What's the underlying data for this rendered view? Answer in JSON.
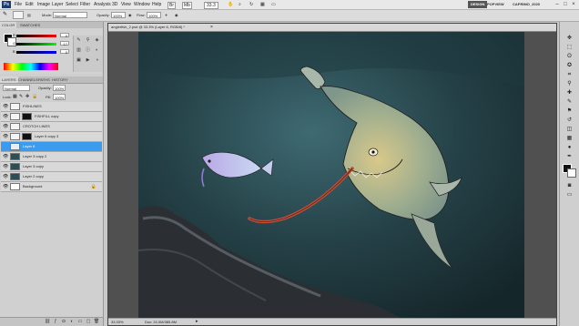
{
  "menu": {
    "items": [
      "File",
      "Edit",
      "Image",
      "Layer",
      "Select",
      "Filter",
      "Analysis",
      "3D",
      "View",
      "Window",
      "Help"
    ],
    "zoom": "33.3"
  },
  "workspaces": {
    "design": "DESIGN",
    "preview": "POPVIEW",
    "painting": "CAPRIMO_2020"
  },
  "window_controls": {
    "minimize": "–",
    "maximize": "□",
    "close": "×"
  },
  "options": {
    "mode_label": "Mode:",
    "mode_value": "Normal",
    "opacity_label": "Opacity:",
    "opacity_value": "100%",
    "flow_label": "Flow:",
    "flow_value": "100%"
  },
  "color_panel": {
    "tabs": [
      "COLOR",
      "SWATCHES"
    ],
    "r_label": "R",
    "r_value": "0",
    "g_label": "G",
    "g_value": "17",
    "b_label": "B",
    "b_value": "0",
    "fg_color": "#111111",
    "bg_color": "#ffffff"
  },
  "layers_panel": {
    "tabs": [
      "LAYERS",
      "CHANNELS",
      "PATHS",
      "HISTORY"
    ],
    "blend_label": "Normal",
    "opacity_label": "Opacity:",
    "opacity_value": "100%",
    "lock_label": "Lock:",
    "fill_label": "Fill:",
    "fill_value": "100%",
    "layers": [
      {
        "name": "FISHLINES",
        "visible": true,
        "selected": false,
        "thumb": "#f4f4f4",
        "mask": false
      },
      {
        "name": "FISHFILL copy",
        "visible": true,
        "selected": false,
        "thumb": "#f4f4f4",
        "mask": true
      },
      {
        "name": "CROTCH LINES",
        "visible": true,
        "selected": false,
        "thumb": "#f4f4f4",
        "mask": false
      },
      {
        "name": "Layer 6 copy 3",
        "visible": true,
        "selected": false,
        "thumb": "#f4f4f4",
        "mask": true
      },
      {
        "name": "Layer 6",
        "visible": false,
        "selected": true,
        "thumb": "#e6eef8",
        "mask": false
      },
      {
        "name": "Layer 3 copy 2",
        "visible": true,
        "selected": false,
        "thumb": "#2c4e55",
        "mask": false
      },
      {
        "name": "Layer 3 copy",
        "visible": true,
        "selected": false,
        "thumb": "#2c4e55",
        "mask": false
      },
      {
        "name": "Layer 2 copy",
        "visible": true,
        "selected": false,
        "thumb": "#2c4e55",
        "mask": false
      },
      {
        "name": "Background",
        "visible": true,
        "selected": false,
        "thumb": "#ffffff",
        "mask": false,
        "locked": true
      }
    ],
    "footer_icons": [
      "link-icon",
      "fx-icon",
      "mask-icon",
      "adjustment-icon",
      "group-icon",
      "new-layer-icon",
      "trash-icon"
    ]
  },
  "document": {
    "title": "anglerfish_2.psd @ 33.3% (Layer 6, RGB/8) *",
    "zoom": "33.33%",
    "doc_info": "Doc: 24.0M/385.8M"
  },
  "colors": {
    "selected_layer": "#3a9bef",
    "canvas_dark": "#15262a",
    "canvas_light": "#3f6a72"
  }
}
